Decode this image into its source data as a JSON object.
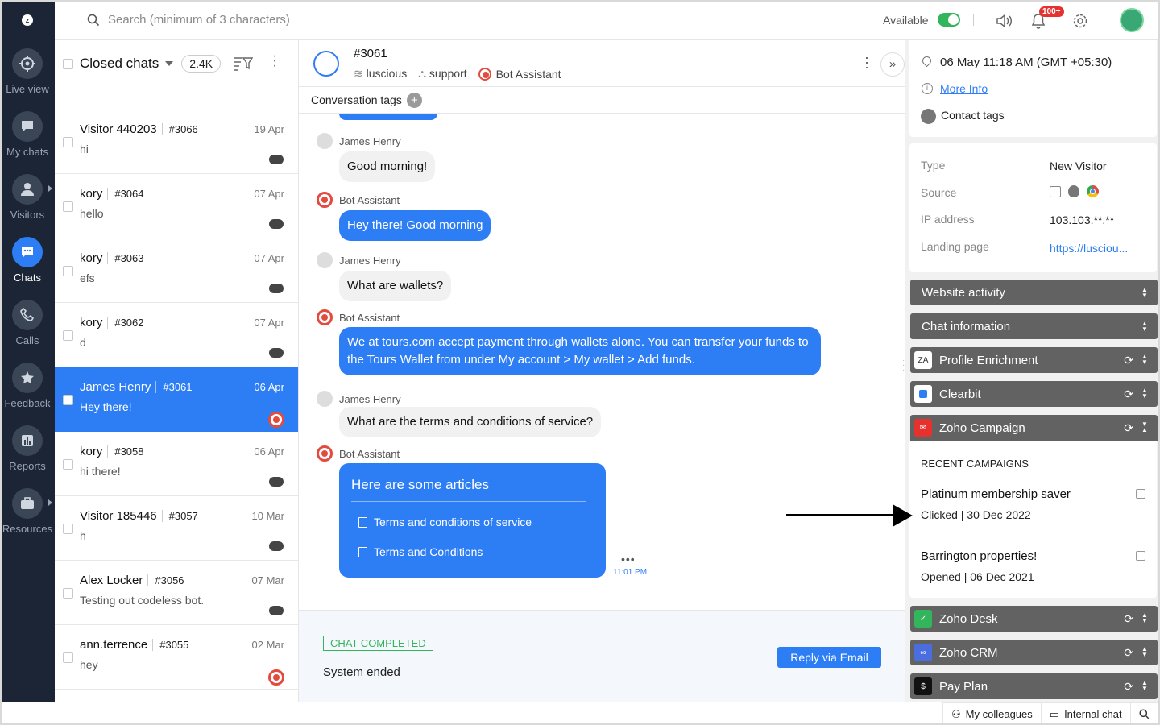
{
  "nav": {
    "items": [
      {
        "label": "Live view",
        "icon": "target-icon"
      },
      {
        "label": "My chats",
        "icon": "chat-bubble-icon"
      },
      {
        "label": "Visitors",
        "icon": "user-icon"
      },
      {
        "label": "Chats",
        "icon": "chats-icon"
      },
      {
        "label": "Calls",
        "icon": "phone-icon"
      },
      {
        "label": "Feedback",
        "icon": "star-icon"
      },
      {
        "label": "Reports",
        "icon": "bar-chart-icon"
      },
      {
        "label": "Resources",
        "icon": "briefcase-icon"
      }
    ],
    "active": "Chats"
  },
  "header": {
    "search_placeholder": "Search (minimum of 3 characters)",
    "availability": "Available",
    "notification_badge": "100+"
  },
  "list": {
    "title": "Closed chats",
    "count": "2.4K",
    "items": [
      {
        "name": "Visitor 440203",
        "num": "#3066",
        "date": "19 Apr",
        "msg": "hi",
        "avatar": "mask"
      },
      {
        "name": "kory",
        "num": "#3064",
        "date": "07 Apr",
        "msg": "hello",
        "avatar": "photo"
      },
      {
        "name": "kory",
        "num": "#3063",
        "date": "07 Apr",
        "msg": "efs",
        "avatar": "photo"
      },
      {
        "name": "kory",
        "num": "#3062",
        "date": "07 Apr",
        "msg": "d",
        "avatar": "photo"
      },
      {
        "name": "James Henry",
        "num": "#3061",
        "date": "06 Apr",
        "msg": "Hey there!",
        "avatar": "bot"
      },
      {
        "name": "kory",
        "num": "#3058",
        "date": "06 Apr",
        "msg": "hi there!",
        "avatar": "mask"
      },
      {
        "name": "Visitor 185446",
        "num": "#3057",
        "date": "10 Mar",
        "msg": "h",
        "avatar": "mask"
      },
      {
        "name": "Alex Locker",
        "num": "#3056",
        "date": "07 Mar",
        "msg": "Testing out codeless bot.",
        "avatar": "mask"
      },
      {
        "name": "ann.terrence",
        "num": "#3055",
        "date": "02 Mar",
        "msg": "hey",
        "avatar": "bot"
      }
    ]
  },
  "chat": {
    "id": "#3061",
    "meta": {
      "brand": "luscious",
      "department": "support",
      "bot": "Bot Assistant"
    },
    "tags_label": "Conversation tags",
    "messages": [
      {
        "sender": "James Henry",
        "type": "user",
        "text": "Good morning!"
      },
      {
        "sender": "Bot Assistant",
        "type": "bot",
        "text": "Hey there! Good morning"
      },
      {
        "sender": "James Henry",
        "type": "user",
        "text": "What are wallets?"
      },
      {
        "sender": "Bot Assistant",
        "type": "bot",
        "text": "We at tours.com accept payment through wallets alone. You can transfer your funds to the Tours Wallet from under My account > My wallet > Add funds."
      },
      {
        "sender": "James Henry",
        "type": "user",
        "text": "What are the terms and conditions of service?"
      },
      {
        "sender": "Bot Assistant",
        "type": "bot",
        "text": ""
      }
    ],
    "articles": {
      "title": "Here are some articles",
      "links": [
        "Terms and conditions of service",
        "Terms and Conditions"
      ]
    },
    "time": "11:01 PM",
    "status": "CHAT COMPLETED",
    "ended": "System ended",
    "reply_button": "Reply via Email"
  },
  "right": {
    "datetime": "06 May 11:18 AM  (GMT +05:30)",
    "more_info": "More Info",
    "contact_tags": "Contact tags",
    "details": [
      {
        "label": "Type",
        "value": "New Visitor"
      },
      {
        "label": "Source",
        "value": ""
      },
      {
        "label": "IP address",
        "value": "103.103.**.**"
      },
      {
        "label": "Landing page",
        "value": "https://lusciou..."
      }
    ],
    "sections": [
      {
        "label": "Website activity"
      },
      {
        "label": "Chat information"
      },
      {
        "label": "Profile Enrichment"
      },
      {
        "label": "Clearbit"
      },
      {
        "label": "Zoho Campaign"
      },
      {
        "label": "Zoho Desk"
      },
      {
        "label": "Zoho CRM"
      },
      {
        "label": "Pay Plan"
      }
    ],
    "recent_campaigns_title": "RECENT CAMPAIGNS",
    "campaigns": [
      {
        "name": "Platinum membership saver",
        "status": "Clicked | 30 Dec 2022"
      },
      {
        "name": "Barrington properties!",
        "status": "Opened | 06 Dec 2021"
      }
    ]
  },
  "bottom": {
    "colleagues": "My colleagues",
    "internal_chat": "Internal chat"
  },
  "colors": {
    "accent": "#2d7df5",
    "nav_bg": "#1b2535",
    "available": "#33b55c",
    "bot_red": "#e34b3f"
  }
}
